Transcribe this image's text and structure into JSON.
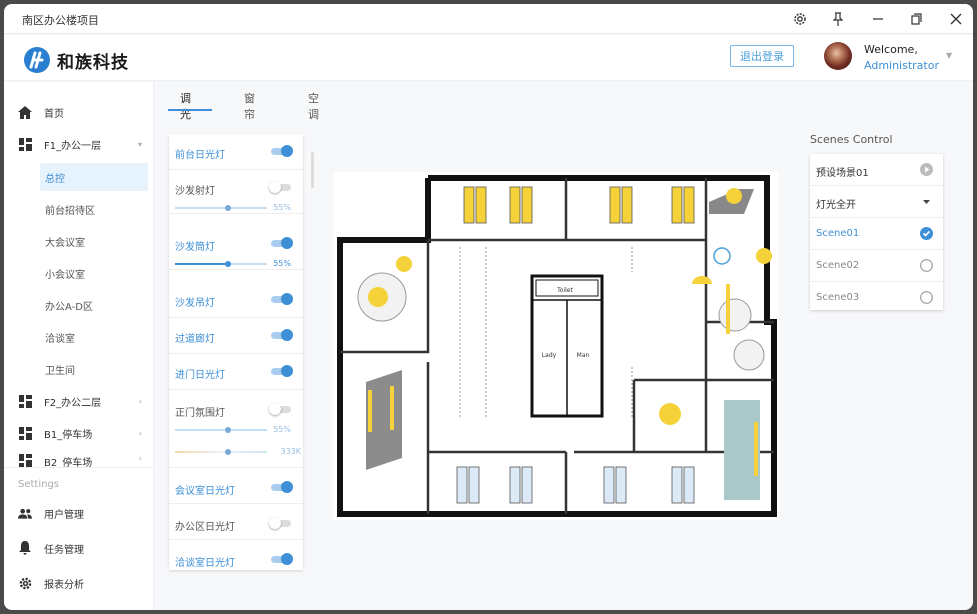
{
  "window": {
    "title": "南区办公楼项目"
  },
  "header": {
    "brand": "和族科技",
    "logout_label": "退出登录",
    "welcome": "Welcome,",
    "role": "Administrator"
  },
  "sidebar": {
    "home": "首页",
    "floor1": "F1_办公一层",
    "floor1_items": [
      "总控",
      "前台招待区",
      "大会议室",
      "小会议室",
      "办公A-D区",
      "洽谈室",
      "卫生间"
    ],
    "floor2": "F2_办公二层",
    "b1": "B1_停车场",
    "b2": "B2_停车场",
    "settings_label": "Settings",
    "settings_items": [
      "用户管理",
      "任务管理",
      "报表分析"
    ]
  },
  "tabs": [
    "调光",
    "窗帘",
    "空调"
  ],
  "lights": [
    {
      "name": "前台日光灯",
      "on": true
    },
    {
      "name": "沙发射灯",
      "on": false,
      "level_label": "55%",
      "level": 0.55
    },
    {
      "name": "沙发筒灯",
      "on": true,
      "level_label": "55%",
      "level": 0.55
    },
    {
      "name": "沙发吊灯",
      "on": true
    },
    {
      "name": "过道廊灯",
      "on": true
    },
    {
      "name": "进门日光灯",
      "on": true
    },
    {
      "name": "正门氛围灯",
      "on": false,
      "level_label": "55%",
      "level": 0.55,
      "temp_label": "333K",
      "temp": 0.55
    },
    {
      "name": "会议室日光灯",
      "on": true
    },
    {
      "name": "办公区日光灯",
      "on": false
    },
    {
      "name": "洽谈室日光灯",
      "on": true
    }
  ],
  "floorplan": {
    "rooms": [
      "Toilet",
      "Lady",
      "Man"
    ]
  },
  "scenes": {
    "title": "Scenes Control",
    "preset": "预设场景01",
    "select": "灯光全开",
    "options": [
      {
        "label": "Scene01",
        "selected": true
      },
      {
        "label": "Scene02",
        "selected": false
      },
      {
        "label": "Scene03",
        "selected": false
      }
    ]
  },
  "colors": {
    "accent": "#3d8fd6",
    "bulb": "#f5d23a"
  }
}
